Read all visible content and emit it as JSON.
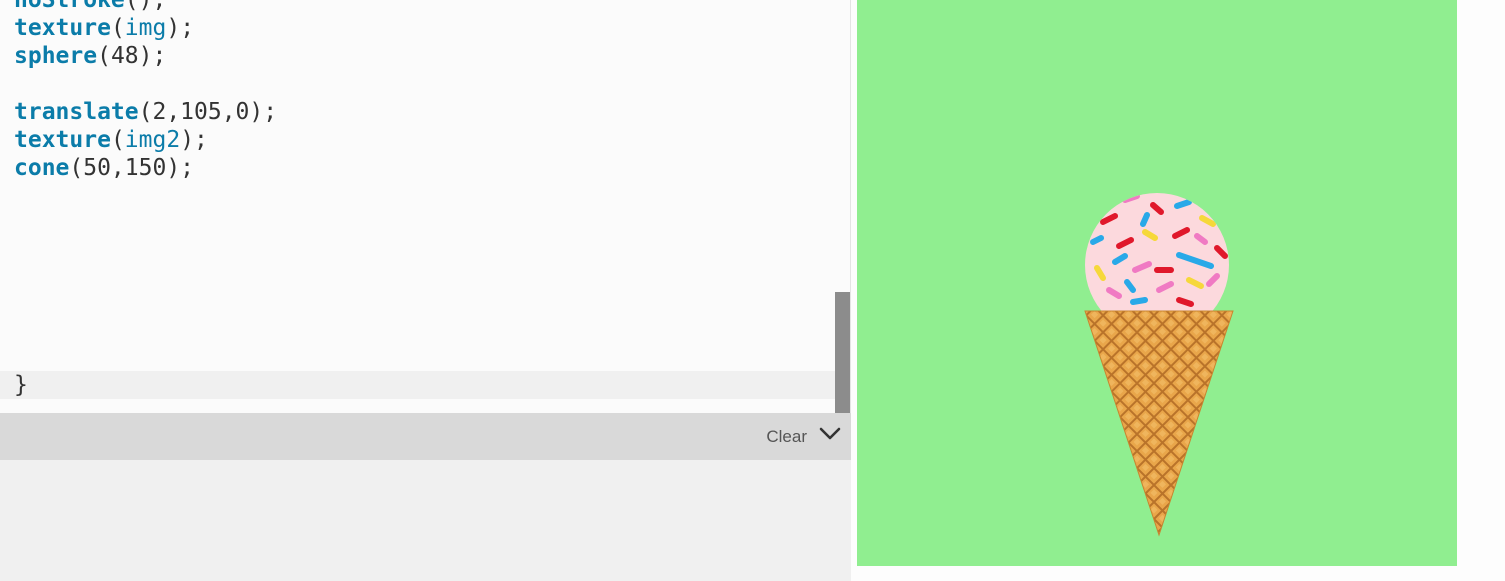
{
  "editor": {
    "lines": [
      [
        {
          "t": "noStroke",
          "c": "fn"
        },
        {
          "t": "();",
          "c": "plain"
        }
      ],
      [
        {
          "t": "texture",
          "c": "fn"
        },
        {
          "t": "(",
          "c": "plain"
        },
        {
          "t": "img",
          "c": "var"
        },
        {
          "t": ");",
          "c": "plain"
        }
      ],
      [
        {
          "t": "sphere",
          "c": "fn"
        },
        {
          "t": "(48);",
          "c": "plain"
        }
      ],
      [],
      [
        {
          "t": "translate",
          "c": "fn"
        },
        {
          "t": "(2,105,0);",
          "c": "plain"
        }
      ],
      [
        {
          "t": "texture",
          "c": "fn"
        },
        {
          "t": "(",
          "c": "plain"
        },
        {
          "t": "img2",
          "c": "var"
        },
        {
          "t": ");",
          "c": "plain"
        }
      ],
      [
        {
          "t": "cone",
          "c": "fn"
        },
        {
          "t": "(50,150);",
          "c": "plain"
        }
      ]
    ],
    "closing_brace": "}"
  },
  "console": {
    "clear_label": "Clear",
    "collapse_icon": "chevron-down-icon"
  },
  "preview": {
    "background_color": "#90ee90",
    "scoop_color": "#fcd9dd",
    "cone_color": "#e9a64a"
  }
}
